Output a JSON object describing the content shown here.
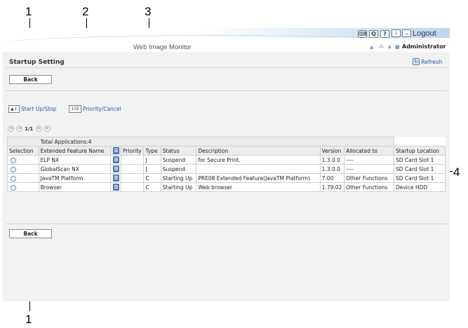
{
  "callouts": {
    "c1_top": "1",
    "c2": "2",
    "c3": "3",
    "c4": "4",
    "c1_bottom": "1"
  },
  "header": {
    "app_title": "Web Image Monitor",
    "logout_label": "Logout",
    "user_name": "Administrator"
  },
  "page": {
    "title": "Startup Setting",
    "refresh_label": "Refresh",
    "back_label": "Back",
    "back_bottom_label": "Back"
  },
  "actions": {
    "start_stop_label": "Start Up/Stop",
    "priority_cancel_label": "Priority/Cancel"
  },
  "pager": {
    "page_label": "1/1"
  },
  "table": {
    "total_label": "Total Applications:4",
    "headers": {
      "selection": "Selection",
      "name": "Extended Feature Name",
      "priority": "Priority",
      "type": "Type",
      "status": "Status",
      "description": "Description",
      "version": "Version",
      "allocated": "Allocated to",
      "location": "Startup Location"
    },
    "rows": [
      {
        "name": "ELP NX",
        "priority": "",
        "type": "J",
        "status": "Suspend",
        "description": "for Secure Print.",
        "version": "1.3.0.0",
        "allocated": "----",
        "location": "SD Card Slot 1"
      },
      {
        "name": "GlobalScan NX",
        "priority": "",
        "type": "J",
        "status": "Suspend",
        "description": "",
        "version": "1.3.0.0",
        "allocated": "----",
        "location": "SD Card Slot 1"
      },
      {
        "name": "JavaTM Platform",
        "priority": "",
        "type": "C",
        "status": "Starting Up",
        "description": "PRE08 Extended Feature(JavaTM Platform)",
        "version": "7.00",
        "allocated": "Other Functions",
        "location": "SD Card Slot 1"
      },
      {
        "name": "Browser",
        "priority": "",
        "type": "C",
        "status": "Starting Up",
        "description": "Web browser",
        "version": "1.79.02",
        "allocated": "Other Functions",
        "location": "Device HDD"
      }
    ]
  }
}
